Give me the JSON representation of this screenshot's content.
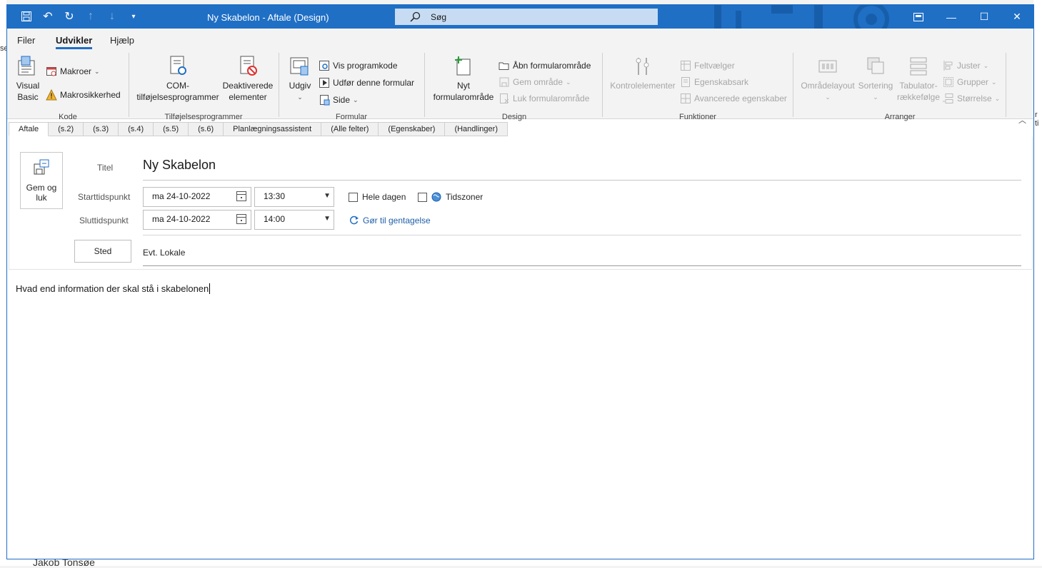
{
  "window": {
    "title": "Ny Skabelon  -  Aftale  (Design)",
    "search_placeholder": "Søg"
  },
  "menu": [
    "Filer",
    "Udvikler",
    "Hjælp"
  ],
  "menu_active": "Udvikler",
  "ribbon": {
    "kode": {
      "label": "Kode",
      "visual_basic_1": "Visual",
      "visual_basic_2": "Basic",
      "makroer": "Makroer",
      "makrosikkerhed": "Makrosikkerhed"
    },
    "tilfoejelser": {
      "label": "Tilføjelsesprogrammer",
      "com_1": "COM-",
      "com_2": "tilføjelsesprogrammer",
      "deakt_1": "Deaktiverede",
      "deakt_2": "elementer"
    },
    "formular": {
      "label": "Formular",
      "udgiv": "Udgiv",
      "vis_programkode": "Vis programkode",
      "udfoer": "Udfør denne formular",
      "side": "Side"
    },
    "design": {
      "label": "Design",
      "nyt_1": "Nyt",
      "nyt_2": "formularområde",
      "aabn": "Åbn formularområde",
      "gem": "Gem område",
      "luk": "Luk formularområde"
    },
    "funktioner": {
      "label": "Funktioner",
      "kontrol": "Kontrolelementer",
      "feltvaelger": "Feltvælger",
      "egenskabsark": "Egenskabsark",
      "avancerede": "Avancerede egenskaber"
    },
    "arranger": {
      "label": "Arranger",
      "omraadelayout": "Områdelayout",
      "sortering": "Sortering",
      "tab_1": "Tabulator-",
      "tab_2": "rækkefølge",
      "juster": "Juster",
      "grupper": "Grupper",
      "stoerrelse": "Størrelse"
    }
  },
  "form_tabs": [
    "Aftale",
    "(s.2)",
    "(s.3)",
    "(s.4)",
    "(s.5)",
    "(s.6)",
    "Planlægningsassistent",
    "(Alle felter)",
    "(Egenskaber)",
    "(Handlinger)"
  ],
  "form": {
    "gem_og_luk_1": "Gem og",
    "gem_og_luk_2": "luk",
    "titel_label": "Titel",
    "titel_value": "Ny Skabelon",
    "start_label": "Starttidspunkt",
    "start_date": "ma 24-10-2022",
    "start_time": "13:30",
    "slut_label": "Sluttidspunkt",
    "slut_date": "ma 24-10-2022",
    "slut_time": "14:00",
    "hele_dagen": "Hele dagen",
    "tidszoner": "Tidszoner",
    "gentagelse": "Gør til gentagelse",
    "sted_button": "Sted",
    "sted_value": "Evt. Lokale",
    "body": "Hvad end information der skal stå i skabelonen"
  },
  "background": {
    "bottom_name": "Jakob Tonsøe",
    "left_fragment": "se",
    "right_fragment": "r ti"
  },
  "colors": {
    "accent": "#1f6fc5"
  }
}
